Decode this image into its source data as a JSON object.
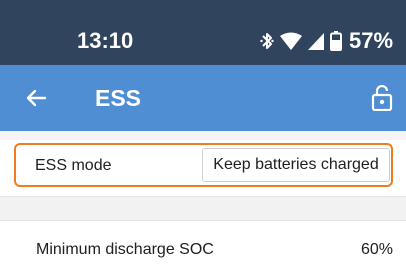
{
  "status_bar": {
    "time": "13:10",
    "battery_percent": "57%",
    "icons": [
      "bluetooth-icon",
      "wifi-icon",
      "cellular-signal-icon",
      "battery-icon"
    ]
  },
  "app_bar": {
    "title": "ESS",
    "back_icon": "arrow-left-icon",
    "lock_icon": "unlocked-padlock-icon",
    "background_color": "#4f8ed3"
  },
  "settings": {
    "ess_mode": {
      "label": "ESS mode",
      "value": "Keep batteries charged",
      "highlight_color": "#f07c1d"
    },
    "min_discharge_soc": {
      "label": "Minimum discharge SOC",
      "value": "60%"
    }
  },
  "colors": {
    "status_bar": "#30455d",
    "accent": "#f07c1d"
  }
}
